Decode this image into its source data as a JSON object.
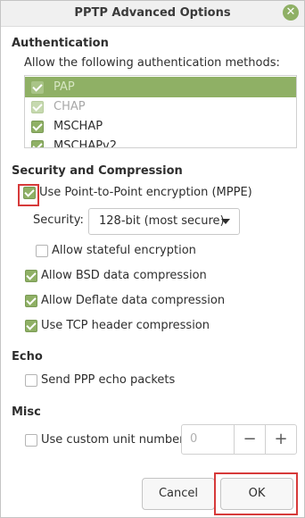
{
  "window": {
    "title": "PPTP Advanced Options",
    "close_icon": "close-icon",
    "accent_color": "#8fb065",
    "highlight_color": "#d63a3a"
  },
  "authentication": {
    "heading": "Authentication",
    "description": "Allow the following authentication methods:",
    "methods": [
      {
        "label": "PAP",
        "checked": true,
        "state": "selected"
      },
      {
        "label": "CHAP",
        "checked": true,
        "state": "disabled"
      },
      {
        "label": "MSCHAP",
        "checked": true,
        "state": "normal"
      },
      {
        "label": "MSCHAPv2",
        "checked": true,
        "state": "normal"
      }
    ]
  },
  "security": {
    "heading": "Security and Compression",
    "mppe_label": "Use Point-to-Point encryption (MPPE)",
    "mppe_checked": true,
    "security_label": "Security:",
    "security_value": "128-bit (most secure)",
    "stateful_label": "Allow stateful encryption",
    "stateful_checked": false,
    "bsd_label": "Allow BSD data compression",
    "bsd_checked": true,
    "deflate_label": "Allow Deflate data compression",
    "deflate_checked": true,
    "tcp_label": "Use TCP header compression",
    "tcp_checked": true
  },
  "echo": {
    "heading": "Echo",
    "echo_label": "Send PPP echo packets",
    "echo_checked": false
  },
  "misc": {
    "heading": "Misc",
    "unit_label": "Use custom unit number:",
    "unit_checked": false,
    "unit_value": "0",
    "minus": "−",
    "plus": "+"
  },
  "buttons": {
    "cancel": "Cancel",
    "ok": "OK"
  }
}
